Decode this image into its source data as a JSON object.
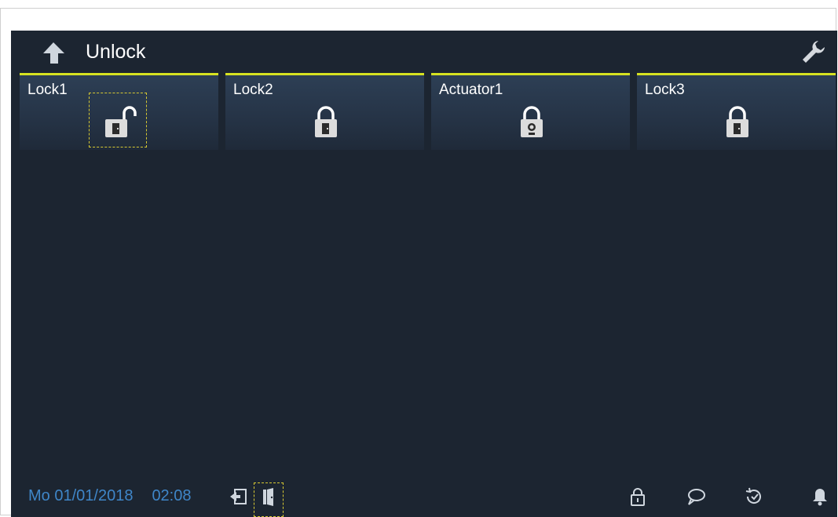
{
  "header": {
    "title": "Unlock",
    "back_icon": "back-arrow-icon",
    "settings_icon": "wrench-icon"
  },
  "tiles": [
    {
      "label": "Lock1",
      "icon": "unlocked-padlock-door-icon",
      "state": "unlocked",
      "focused": true
    },
    {
      "label": "Lock2",
      "icon": "padlock-door-icon",
      "state": "locked",
      "focused": false
    },
    {
      "label": "Actuator1",
      "icon": "padlock-light-icon",
      "state": "locked",
      "focused": false
    },
    {
      "label": "Lock3",
      "icon": "padlock-door-icon",
      "state": "locked",
      "focused": false
    }
  ],
  "footer": {
    "date": "Mo 01/01/2018",
    "time": "02:08",
    "left_icons": [
      "enter-door-icon",
      "door-icon"
    ],
    "right_icons": [
      "lock-icon",
      "message-icon",
      "history-icon",
      "bell-icon"
    ]
  },
  "colors": {
    "background": "#1c2531",
    "accent_bar": "#d6e221",
    "datetime": "#3f86c8",
    "focus_outline": "#d6c832"
  }
}
